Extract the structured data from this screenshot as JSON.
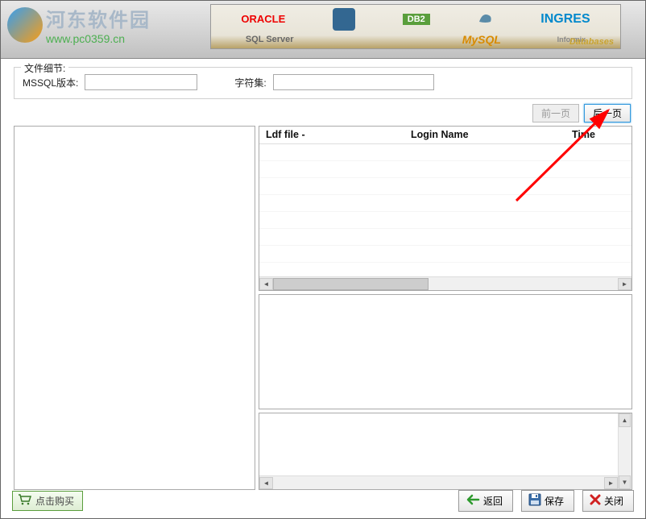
{
  "watermark": {
    "title": "河东软件园",
    "url": "www.pc0359.cn"
  },
  "db_banner": {
    "oracle": "ORACLE",
    "db2": "DB2",
    "ingres": "INGRES",
    "sqlserver": "SQL Server",
    "mysql": "MySQL",
    "informix": "Informix",
    "label": "Databases"
  },
  "details": {
    "legend": "文件细节:",
    "mssql_label": "MSSQL版本:",
    "mssql_value": "",
    "charset_label": "字符集:",
    "charset_value": ""
  },
  "nav": {
    "prev": "前一页",
    "next": "后一页"
  },
  "grid": {
    "columns": {
      "ldf": "Ldf  file -",
      "login": "Login Name",
      "time": "Time"
    },
    "rows": []
  },
  "footer": {
    "buy": "点击购买",
    "back": "返回",
    "save": "保存",
    "close": "关闭"
  }
}
